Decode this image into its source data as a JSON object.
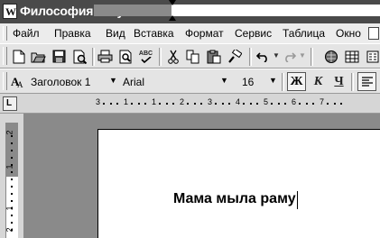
{
  "window": {
    "title": "Философия искусственного интеллекта.doc - Microsoft Word",
    "app_icon_letter": "W"
  },
  "menu": {
    "items": [
      "Файл",
      "Правка",
      "Вид",
      "Вставка",
      "Формат",
      "Сервис",
      "Таблица",
      "Окно"
    ]
  },
  "toolbar_standard": {
    "icons": [
      "new-document-icon",
      "open-folder-icon",
      "save-icon",
      "print-preview-icon",
      "print-icon",
      "spellcheck-icon",
      "cut-icon",
      "copy-icon",
      "paste-icon",
      "format-painter-icon",
      "undo-icon",
      "redo-icon",
      "web-icon",
      "table-icon"
    ],
    "spell_label": "ABC"
  },
  "toolbar_formatting": {
    "style": "Заголовок 1",
    "font": "Arial",
    "size": "16",
    "bold_label": "Ж",
    "italic_label": "К",
    "underline_label": "Ч"
  },
  "ruler": {
    "numbers": [
      "3",
      "1",
      "1",
      "2",
      "3",
      "4",
      "5",
      "6",
      "7"
    ],
    "tab_selector": "L"
  },
  "vertical_ruler": {
    "numbers": [
      "2",
      "1",
      "1",
      "2"
    ]
  },
  "document": {
    "text": "Мама мыла раму"
  },
  "colors": {
    "titlebar": "#4a4a4a",
    "toolbar": "#e4e4e4",
    "workspace": "#8a8a8a",
    "page": "#ffffff"
  }
}
